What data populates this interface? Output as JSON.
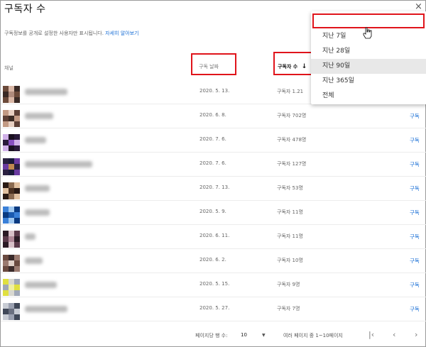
{
  "dialog": {
    "title": "구독자 수",
    "close_icon": "×",
    "description": "구독정보를 공개로 설정한 사용자만 표시됩니다.",
    "learn_more": "자세히 알아보기"
  },
  "table": {
    "headers": {
      "channel": "채널",
      "date": "구독 날짜",
      "subscribers": "구독자 수",
      "sort_arrow": "↓"
    },
    "rows": [
      {
        "date": "2020. 5. 13.",
        "subs": "구독자 1.21",
        "action": ""
      },
      {
        "date": "2020. 6. 8.",
        "subs": "구독자 702명",
        "action": "구독"
      },
      {
        "date": "2020. 7. 6.",
        "subs": "구독자 478명",
        "action": "구독"
      },
      {
        "date": "2020. 7. 6.",
        "subs": "구독자 127명",
        "action": "구독"
      },
      {
        "date": "2020. 7. 13.",
        "subs": "구독자 53명",
        "action": "구독"
      },
      {
        "date": "2020. 5. 9.",
        "subs": "구독자 11명",
        "action": "구독"
      },
      {
        "date": "2020. 6. 11.",
        "subs": "구독자 11명",
        "action": "구독"
      },
      {
        "date": "2020. 6. 2.",
        "subs": "구독자 10명",
        "action": "구독"
      },
      {
        "date": "2020. 5. 15.",
        "subs": "구독자 9명",
        "action": "구독"
      },
      {
        "date": "2020. 5. 27.",
        "subs": "구독자 7명",
        "action": "구독"
      }
    ]
  },
  "footer": {
    "rows_per_page_label": "페이지당 행 수:",
    "rows_per_page_value": "10",
    "range_text": "여러 페이지 중 1~10페이지",
    "first_icon": "|‹",
    "prev_icon": "‹",
    "next_icon": "›"
  },
  "period_dropdown": {
    "options": [
      "지난 7일",
      "지난 28일",
      "지난 90일",
      "지난 365일",
      "전체"
    ],
    "hovered": "지난 90일"
  },
  "colors": {
    "highlight_red": "#e0141b",
    "link_blue": "#1a6fd6"
  }
}
